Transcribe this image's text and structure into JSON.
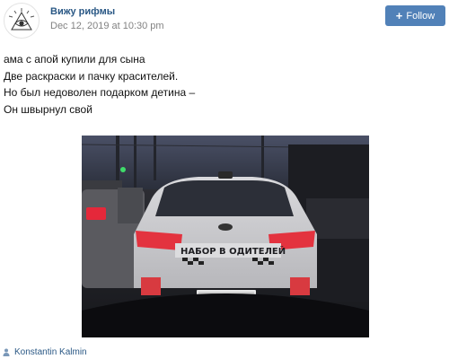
{
  "post": {
    "author": "Вижу рифмы",
    "date": "Dec 12, 2019 at 10:30 pm",
    "follow_label": "Follow",
    "text_lines": [
      "ама с апой купили для сына",
      "Две раскраски и пачку красителей.",
      "Но был недоволен подарком детина –",
      "Он швырнул свой"
    ],
    "photo": {
      "sticker_text": "НАБОР В ОДИТЕЛЕЙ"
    },
    "signature": "Konstantin Kalmin"
  },
  "icons": {
    "avatar": "eye-in-triangle-icon",
    "follow": "plus-icon",
    "signature": "user-icon"
  },
  "colors": {
    "link": "#2a5885",
    "button": "#5181b8",
    "date": "#828282"
  }
}
